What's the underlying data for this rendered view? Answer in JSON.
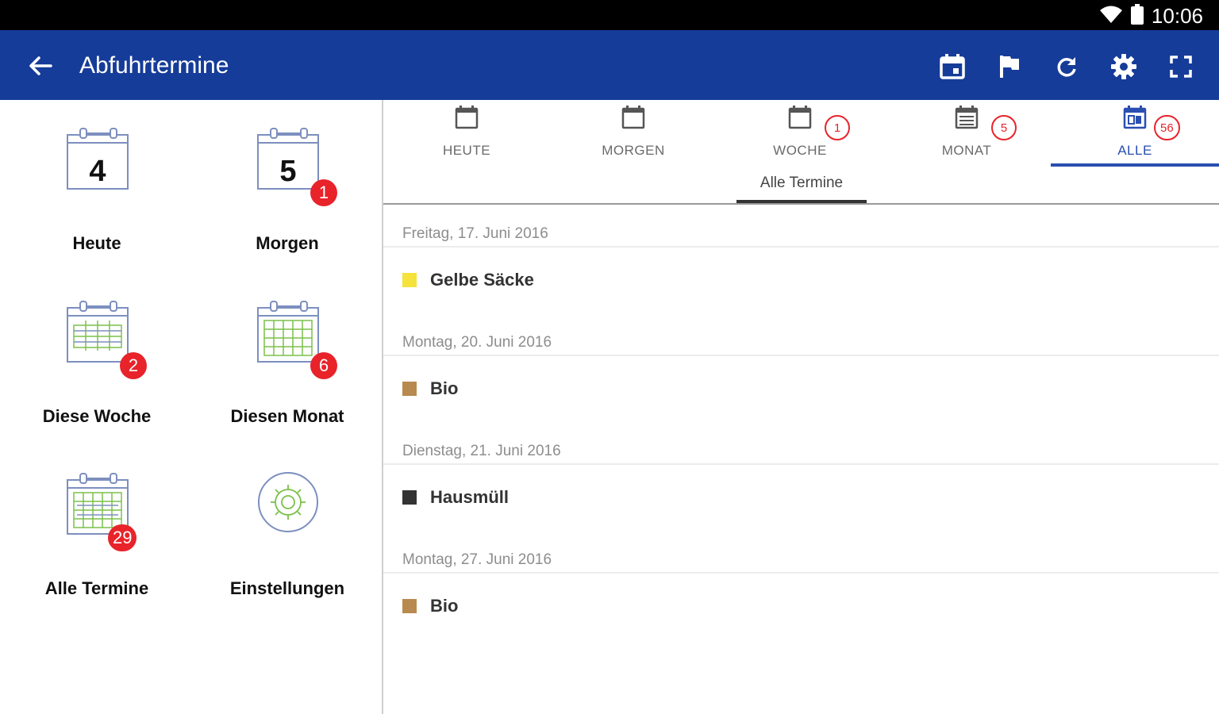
{
  "status_bar": {
    "time": "10:06",
    "icons": [
      "wifi-icon",
      "battery-icon"
    ]
  },
  "app_bar": {
    "title": "Abfuhrtermine",
    "back_icon": "arrow-left-icon",
    "actions": [
      "calendar-today-icon",
      "flag-icon",
      "refresh-icon",
      "settings-icon",
      "fullscreen-icon"
    ]
  },
  "colors": {
    "primary": "#163c99",
    "accent": "#2a4fb0",
    "badge": "#e8232a",
    "gelbe": "#f5e23a",
    "bio": "#b88a4f",
    "hausmuell": "#333333"
  },
  "tiles": [
    {
      "label": "Heute",
      "day": "4",
      "badge": ""
    },
    {
      "label": "Morgen",
      "day": "5",
      "badge": "1"
    },
    {
      "label": "Diese Woche",
      "badge": "2"
    },
    {
      "label": "Diesen Monat",
      "badge": "6"
    },
    {
      "label": "Alle Termine",
      "badge": "29"
    },
    {
      "label": "Einstellungen",
      "badge": ""
    }
  ],
  "tabs": [
    {
      "label": "HEUTE",
      "badge": ""
    },
    {
      "label": "MORGEN",
      "badge": ""
    },
    {
      "label": "WOCHE",
      "badge": "1"
    },
    {
      "label": "MONAT",
      "badge": "5"
    },
    {
      "label": "ALLE",
      "badge": "56",
      "active": true
    }
  ],
  "subtab": {
    "label": "Alle Termine"
  },
  "groups": [
    {
      "date": "Freitag, 17. Juni 2016",
      "items": [
        {
          "label": "Gelbe Säcke",
          "color": "#f5e23a"
        }
      ]
    },
    {
      "date": "Montag, 20. Juni 2016",
      "items": [
        {
          "label": "Bio",
          "color": "#b88a4f"
        }
      ]
    },
    {
      "date": "Dienstag, 21. Juni 2016",
      "items": [
        {
          "label": "Hausmüll",
          "color": "#333333"
        }
      ]
    },
    {
      "date": "Montag, 27. Juni 2016",
      "items": [
        {
          "label": "Bio",
          "color": "#b88a4f"
        }
      ]
    }
  ]
}
